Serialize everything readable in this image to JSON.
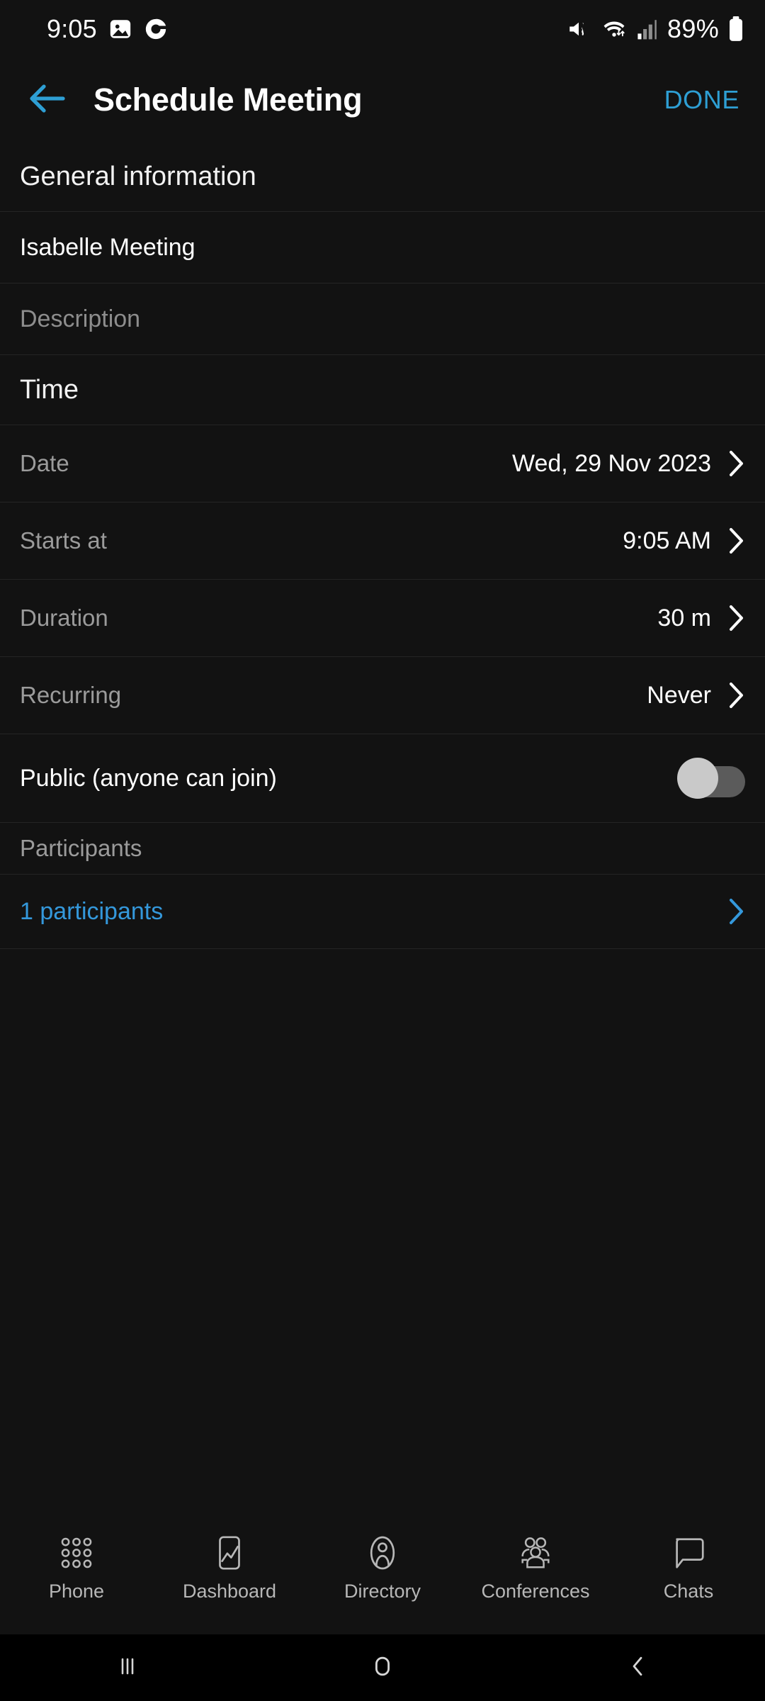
{
  "status_bar": {
    "time": "9:05",
    "battery_percent": "89%",
    "left_icons": [
      "photo-icon",
      "g-app-icon"
    ],
    "right_icons": [
      "volume-mute-icon",
      "wifi-icon",
      "cellular-signal-icon",
      "battery-icon"
    ]
  },
  "app_bar": {
    "back_icon": "arrow-left-icon",
    "title": "Schedule Meeting",
    "done_label": "DONE",
    "accent_color": "#2e9fd4"
  },
  "sections": {
    "general": {
      "header": "General information",
      "name_value": "Isabelle Meeting",
      "description_placeholder": "Description"
    },
    "time": {
      "header": "Time",
      "rows": [
        {
          "label": "Date",
          "value": "Wed, 29 Nov 2023"
        },
        {
          "label": "Starts at",
          "value": "9:05 AM"
        },
        {
          "label": "Duration",
          "value": "30 m"
        },
        {
          "label": "Recurring",
          "value": "Never"
        }
      ]
    },
    "public": {
      "label": "Public (anyone can join)",
      "toggle_state": "off"
    },
    "participants": {
      "header": "Participants",
      "link_label": "1 participants",
      "link_color": "#3498db"
    }
  },
  "bottom_nav": {
    "items": [
      {
        "label": "Phone",
        "icon": "dialpad-icon"
      },
      {
        "label": "Dashboard",
        "icon": "chart-phone-icon"
      },
      {
        "label": "Directory",
        "icon": "person-oval-icon"
      },
      {
        "label": "Conferences",
        "icon": "people-group-icon"
      },
      {
        "label": "Chats",
        "icon": "speech-bubble-icon"
      }
    ]
  },
  "system_nav": {
    "recents": "recents-icon",
    "home": "home-icon",
    "back": "back-icon"
  }
}
